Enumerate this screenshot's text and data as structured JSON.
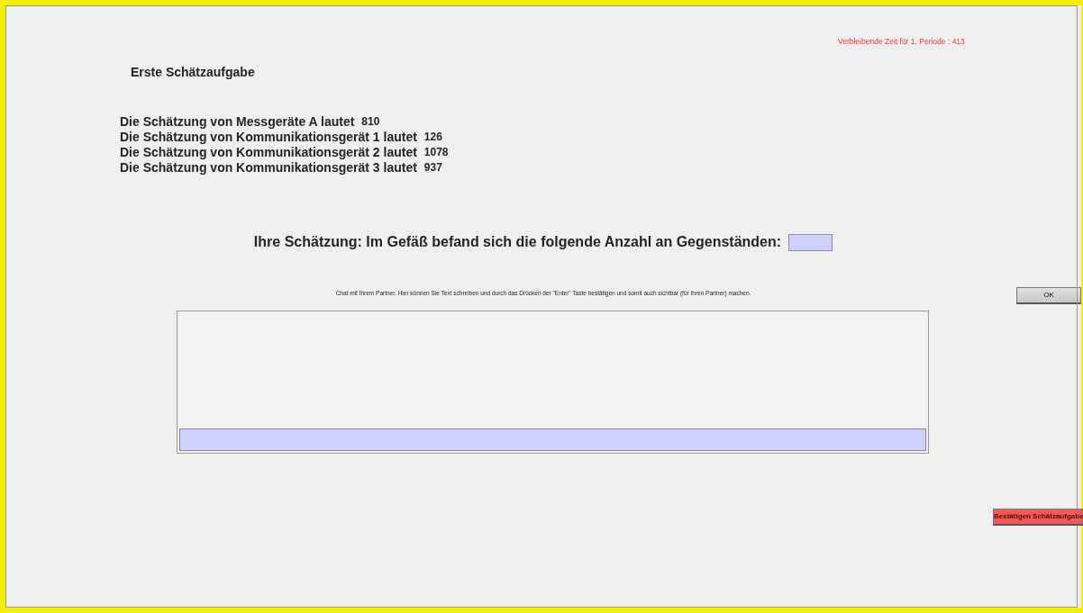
{
  "timer": "Verbleibende Zeit für 1. Periode : 413",
  "title": "Erste Schätzaufgabe",
  "estimates": [
    {
      "label": "Die Schätzung von Messgeräte A lautet",
      "value": "810"
    },
    {
      "label": "Die Schätzung von Kommunikationsgerät 1 lautet",
      "value": "126"
    },
    {
      "label": "Die Schätzung von Kommunikationsgerät 2 lautet",
      "value": "1078"
    },
    {
      "label": "Die Schätzung von Kommunikationsgerät 3 lautet",
      "value": "937"
    }
  ],
  "question": "Ihre Schätzung: Im Gefäß befand sich die folgende Anzahl an Gegenständen:",
  "ok_button": "OK",
  "chat_hint": "Chat mit Ihrem Partner. Hier können Sie Text schreiben und durch das Drücken der \"Enter\" Taste bestätigen und somit auch sichtbar (für Ihren Partner) machen.",
  "confirm_button": "Bestätigen Schätzaufgabe"
}
